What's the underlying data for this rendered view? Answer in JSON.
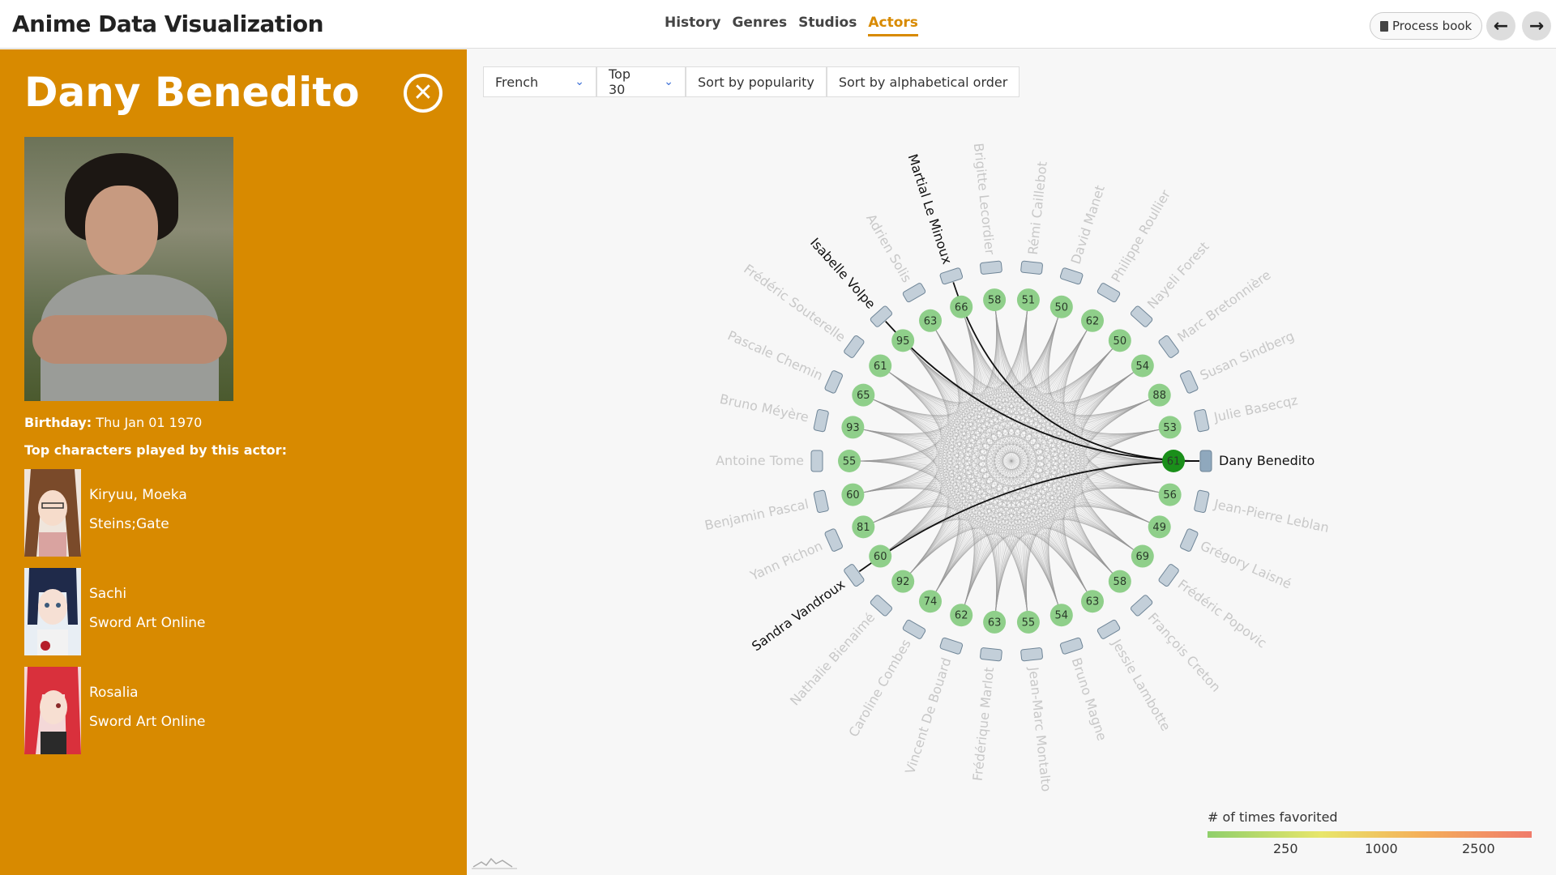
{
  "app": {
    "title": "Anime Data Visualization"
  },
  "nav": {
    "items": [
      {
        "label": "History",
        "active": false
      },
      {
        "label": "Genres",
        "active": false
      },
      {
        "label": "Studios",
        "active": false
      },
      {
        "label": "Actors",
        "active": true
      }
    ],
    "process_book": "Process book",
    "back_icon": "arrow-left-icon",
    "forward_icon": "arrow-right-icon"
  },
  "sidebar": {
    "actor_name": "Dany Benedito",
    "close_icon": "close-circle-icon",
    "birthday_label": "Birthday:",
    "birthday_value": "Thu Jan 01 1970",
    "top_characters_heading": "Top characters played by this actor:",
    "characters": [
      {
        "name": "Kiryuu, Moeka",
        "show": "Steins;Gate"
      },
      {
        "name": "Sachi",
        "show": "Sword Art Online"
      },
      {
        "name": "Rosalia",
        "show": "Sword Art Online"
      }
    ]
  },
  "controls": {
    "language": "French",
    "top_n": "Top 30",
    "sort_popularity": "Sort by popularity",
    "sort_alpha": "Sort by alphabetical order"
  },
  "legend": {
    "title": "# of times favorited",
    "ticks": [
      "250",
      "1000",
      "2500"
    ]
  },
  "chart_data": {
    "type": "chord",
    "selected": "Dany Benedito",
    "highlighted_links": [
      "Martial Le Minoux",
      "Isabelle Volpe",
      "Sandra Vandroux"
    ],
    "actors": [
      {
        "name": "Dany Benedito",
        "count": 61
      },
      {
        "name": "Jean-Pierre Leblan",
        "count": 56
      },
      {
        "name": "Grégory Laisné",
        "count": 49
      },
      {
        "name": "Frédéric Popovic",
        "count": 69
      },
      {
        "name": "François Creton",
        "count": 58
      },
      {
        "name": "Jessie Lambotte",
        "count": 63
      },
      {
        "name": "Bruno Magne",
        "count": 54
      },
      {
        "name": "Jean-Marc Montalto",
        "count": 55
      },
      {
        "name": "Frédérique Marlot",
        "count": 63
      },
      {
        "name": "Vincent De Bouard",
        "count": 62
      },
      {
        "name": "Caroline Combes",
        "count": 74
      },
      {
        "name": "Nathalie Bienaimé",
        "count": 92
      },
      {
        "name": "Sandra Vandroux",
        "count": 60
      },
      {
        "name": "Yann Pichon",
        "count": 81
      },
      {
        "name": "Benjamin Pascal",
        "count": 60
      },
      {
        "name": "Antoine Tome",
        "count": 55
      },
      {
        "name": "Bruno Méyère",
        "count": 93
      },
      {
        "name": "Pascale Chemin",
        "count": 65
      },
      {
        "name": "Frédéric Souterelle",
        "count": 61
      },
      {
        "name": "Isabelle Volpe",
        "count": 95
      },
      {
        "name": "Adrien Solis",
        "count": 63
      },
      {
        "name": "Martial Le Minoux",
        "count": 66
      },
      {
        "name": "Brigitte Lecordier",
        "count": 58
      },
      {
        "name": "Rémi Caillebot",
        "count": 51
      },
      {
        "name": "David Manet",
        "count": 50
      },
      {
        "name": "Philippe Roullier",
        "count": 62
      },
      {
        "name": "Nayeli Forest",
        "count": 50
      },
      {
        "name": "Marc Bretonnière",
        "count": 54
      },
      {
        "name": "Susan Sindberg",
        "count": 88
      },
      {
        "name": "Julie Basecqz",
        "count": 53
      }
    ]
  }
}
